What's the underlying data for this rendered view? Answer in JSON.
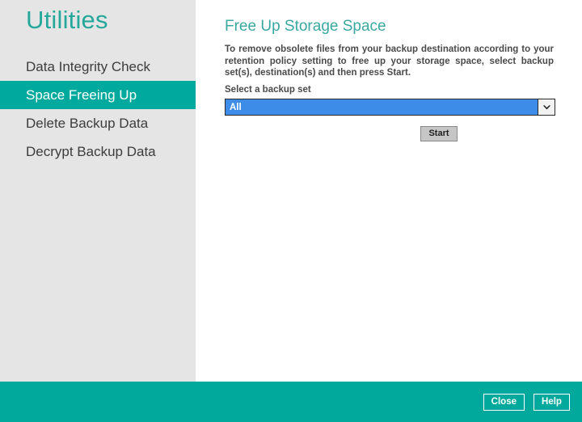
{
  "sidebar": {
    "title": "Utilities",
    "items": [
      {
        "label": "Data Integrity Check",
        "selected": false
      },
      {
        "label": "Space Freeing Up",
        "selected": true
      },
      {
        "label": "Delete Backup Data",
        "selected": false
      },
      {
        "label": "Decrypt Backup Data",
        "selected": false
      }
    ]
  },
  "main": {
    "title": "Free Up Storage Space",
    "description": "To remove obsolete files from your backup destination according to your retention policy setting to free up your storage space, select backup set(s), destination(s) and then press Start.",
    "backup_set": {
      "label": "Select a backup set",
      "selected_value": "All",
      "options": [
        "All"
      ],
      "arrow_icon": "chevron-down-icon"
    },
    "start_label": "Start"
  },
  "footer": {
    "close_label": "Close",
    "help_label": "Help"
  },
  "colors": {
    "teal": "#00a99d",
    "teal_footer": "#00a99b",
    "title_teal": "#24a89c",
    "panel_title_teal": "#3aa8a0",
    "sidebar_bg": "#e5e5e5",
    "select_blue": "#3d8ce8",
    "button_gray": "#c6c6c6",
    "text_dark": "#4a4a4a"
  }
}
